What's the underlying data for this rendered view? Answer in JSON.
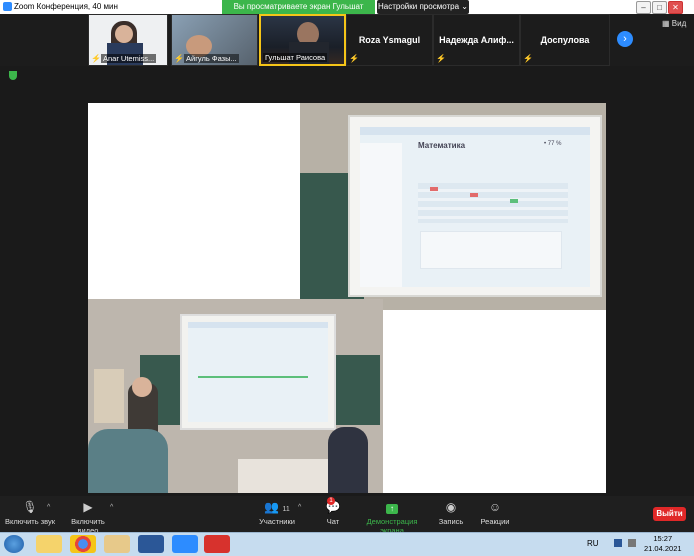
{
  "titlebar": {
    "title": "Zoom Конференция, 40 мин",
    "share_banner": "Вы просматриваете экран Гульшат Раисова",
    "view_options": "Настройки просмотра ⌄"
  },
  "strip": {
    "participants": [
      {
        "name": "Anar Utemiss...",
        "muted": true
      },
      {
        "name": "Айгуль Фазы...",
        "muted": true
      },
      {
        "name": "Гульшат Раисова",
        "muted": false,
        "active": true
      },
      {
        "name": "Roza Ysmagul",
        "muted": true
      },
      {
        "name": "Надежда Алиф...",
        "muted": true
      },
      {
        "name": "Доспулова",
        "muted": true
      }
    ],
    "view_label": "Вид"
  },
  "slide": {
    "heading": "Математика",
    "percent": "• 77 %"
  },
  "toolbar": {
    "unmute": "Включить звук",
    "video": "Включить видео",
    "participants": "Участники",
    "participants_count": "11",
    "chat": "Чат",
    "chat_badge": "1",
    "share": "Демонстрация экрана",
    "record": "Запись",
    "reactions": "Реакции",
    "leave": "Выйти"
  },
  "taskbar": {
    "lang": "RU",
    "time": "15:27",
    "date": "21.04.2021"
  },
  "colors": {
    "accent": "#2d8cff",
    "share_green": "#3cb64b",
    "leave_red": "#e02828"
  }
}
